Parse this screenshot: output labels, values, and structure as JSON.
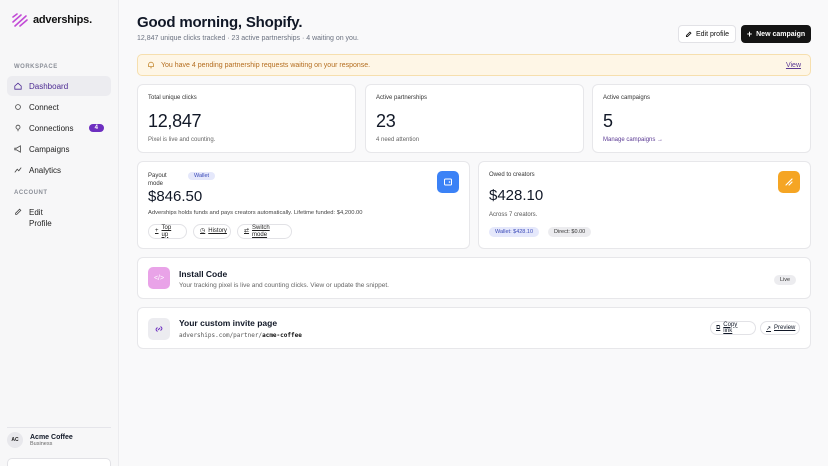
{
  "brand": {
    "name": "adverships.",
    "accent": "#6d2fc0"
  },
  "sidebar": {
    "workspace_label": "WORKSPACE",
    "account_label": "ACCOUNT",
    "items": [
      {
        "label": "Dashboard",
        "icon": "home-icon"
      },
      {
        "label": "Connect",
        "icon": "link-icon"
      },
      {
        "label": "Connections",
        "icon": "pin-icon",
        "badge": "4"
      },
      {
        "label": "Campaigns",
        "icon": "megaphone-icon"
      },
      {
        "label": "Analytics",
        "icon": "chart-icon"
      },
      {
        "label": "Edit\nProfile",
        "icon": "edit-icon"
      }
    ],
    "user": {
      "initials": "AC",
      "name": "Acme Coffee",
      "plan": "Business"
    }
  },
  "header": {
    "title": "Good morning, Shopify.",
    "subtitle": "12,847 unique clicks tracked · 23 active partnerships · 4 waiting on you.",
    "edit_profile": "Edit profile",
    "new_campaign": "New campaign"
  },
  "alert": {
    "text": "You have 4 pending partnership requests waiting on your response.",
    "link": "View"
  },
  "stats": [
    {
      "label": "Total unique clicks",
      "value": "12,847",
      "note": "Pixel is live and counting."
    },
    {
      "label": "Active partnerships",
      "value": "23",
      "note": "4 need attention"
    },
    {
      "label": "Active campaigns",
      "value": "5",
      "note": "Manage campaigns →"
    }
  ],
  "payout": {
    "label": "Payout mode",
    "badge": "Wallet",
    "amount": "$846.50",
    "note": "Adverships holds funds and pays creators automatically. Lifetime funded: $4,200.00",
    "buttons": [
      "Top up",
      "History",
      "Switch mode"
    ]
  },
  "owed": {
    "label": "Owed to creators",
    "amount": "$428.10",
    "note": "Across 7 creators.",
    "pills": [
      "Wallet: $428.10",
      "Direct: $0.00"
    ]
  },
  "install": {
    "title": "Install Code",
    "subtitle": "Your tracking pixel is live and counting clicks. View or update the snippet.",
    "status": "Live"
  },
  "invite": {
    "title": "Your custom invite page",
    "url_prefix": "adverships.com/partner/",
    "url_slug": "acme-coffee",
    "copy": "Copy link",
    "preview": "Preview"
  }
}
